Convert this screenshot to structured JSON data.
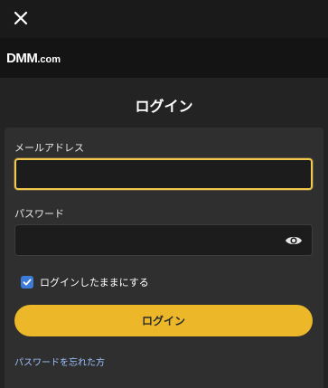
{
  "header": {
    "close_icon": "close-icon",
    "logo_main": "DMM",
    "logo_suffix": ".com"
  },
  "page": {
    "title": "ログイン"
  },
  "form": {
    "email_label": "メールアドレス",
    "email_value": "",
    "email_placeholder": "",
    "password_label": "パスワード",
    "password_value": "",
    "password_placeholder": "",
    "password_toggle_icon": "eye-icon",
    "remember_label": "ログインしたままにする",
    "remember_checked": true,
    "login_button_label": "ログイン",
    "forgot_password_link": "パスワードを忘れた方"
  },
  "colors": {
    "background": "#232323",
    "card": "#2f2f2f",
    "accent": "#ecb82a",
    "focus_border": "#f2c94c",
    "checkbox": "#3d7bd9",
    "link": "#9ec1ff"
  }
}
